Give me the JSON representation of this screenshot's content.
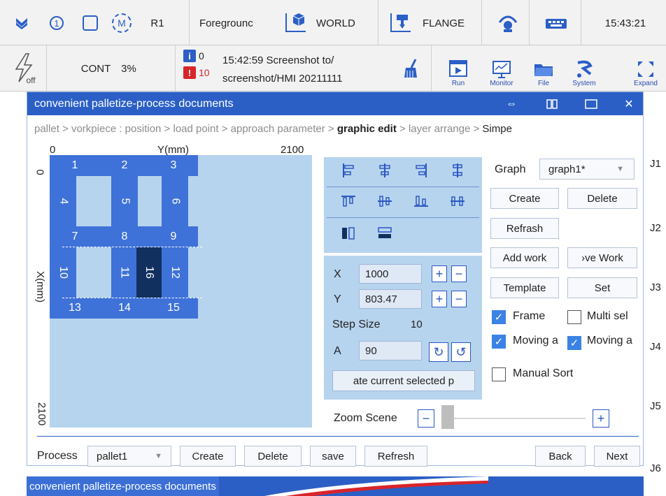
{
  "status": {
    "mode_icon": "double-chevron-down-icon",
    "coord_index": "1",
    "robot": "R1",
    "foreground": "Foregrounc",
    "world": "WORLD",
    "flange": "FLANGE",
    "time": "15:43:21",
    "power": "off",
    "run_mode": "CONT",
    "speed": "3%",
    "info_count": "0",
    "error_count": "10",
    "message_line1": "15:42:59 Screenshot to/",
    "message_line2": "screenshot/HMI 20211111"
  },
  "toolbar": {
    "run": "Run",
    "monitor": "Monitor",
    "file": "File",
    "system": "System",
    "expand": "Expand"
  },
  "window": {
    "title": "convenient palletize-process documents",
    "breadcrumb": [
      {
        "label": "pallet > ",
        "state": "done"
      },
      {
        "label": "vorkpiece ",
        "state": "done"
      },
      {
        "label": ": position > ",
        "state": "done"
      },
      {
        "label": "load point > ",
        "state": "done"
      },
      {
        "label": "approach parameter > ",
        "state": "done"
      },
      {
        "label": "graphic edit",
        "state": "active"
      },
      {
        "label": " > layer arrange > ",
        "state": "todo"
      },
      {
        "label": " Simpe",
        "state": "next"
      }
    ]
  },
  "canvas": {
    "x_min": "0",
    "x_axis": "Y(mm)",
    "x_max": "2100",
    "y_min": "0",
    "y_axis": "X(mm)",
    "y_max": "2100",
    "cells": [
      "1",
      "2",
      "3",
      "4",
      "5",
      "6",
      "7",
      "8",
      "9",
      "10",
      "11",
      "16",
      "12",
      "13",
      "14",
      "15"
    ]
  },
  "props": {
    "x_label": "X",
    "x_value": "1000",
    "y_label": "Y",
    "y_value": "803.47",
    "step_label": "Step Size",
    "step_value": "10",
    "a_label": "A",
    "a_value": "90",
    "rotate_button": "ate current selected p",
    "zoom_label": "Zoom Scene",
    "zoom_level": 0
  },
  "right": {
    "graph_label": "Graph",
    "graph_value": "graph1*",
    "create": "Create",
    "delete": "Delete",
    "refresh": "Refrash",
    "add_work": "Add work",
    "remove_work": "›ve Work",
    "template": "Template",
    "set": "Set",
    "frame": "Frame",
    "frame_checked": true,
    "multi_sel": "Multi sel",
    "multi_sel_checked": false,
    "moving_a1": "Moving a",
    "moving_a1_checked": true,
    "moving_a2": "Moving a",
    "moving_a2_checked": true,
    "manual_sort": "Manual Sort",
    "manual_sort_checked": false
  },
  "bottom": {
    "process_label": "Process",
    "process_value": "pallet1",
    "create": "Create",
    "delete": "Delete",
    "save": "save",
    "refresh": "Refresh",
    "back": "Back",
    "next": "Next"
  },
  "joints": [
    "J1",
    "J2",
    "J3",
    "J4",
    "J5",
    "J6"
  ],
  "taskbar": {
    "title": "convenient palletize-process documents"
  }
}
